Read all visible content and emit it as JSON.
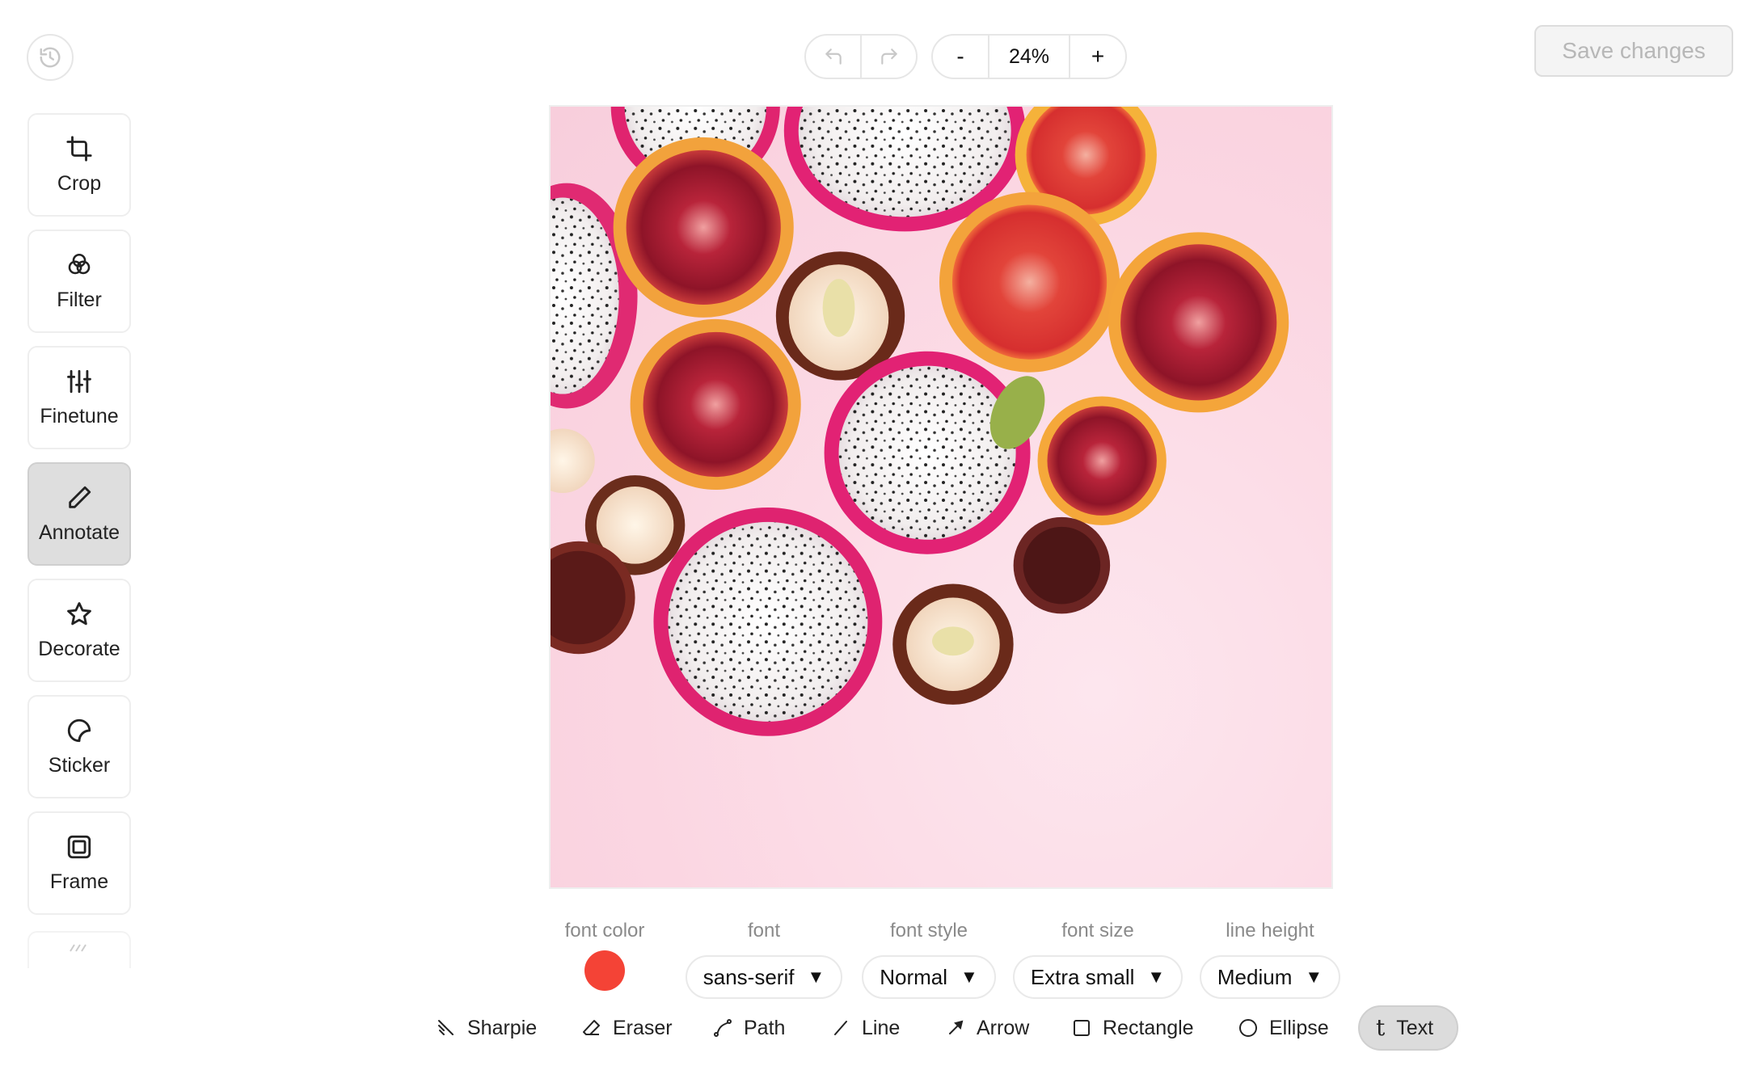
{
  "toolbar": {
    "zoom_out_label": "-",
    "zoom_value": "24%",
    "zoom_in_label": "+",
    "save_label": "Save changes"
  },
  "sidebar": {
    "items": [
      {
        "label": "Crop",
        "icon": "crop-icon"
      },
      {
        "label": "Filter",
        "icon": "filter-icon"
      },
      {
        "label": "Finetune",
        "icon": "sliders-icon"
      },
      {
        "label": "Annotate",
        "icon": "pencil-icon",
        "active": true
      },
      {
        "label": "Decorate",
        "icon": "star-icon"
      },
      {
        "label": "Sticker",
        "icon": "sticker-icon"
      },
      {
        "label": "Frame",
        "icon": "frame-icon"
      }
    ]
  },
  "text_settings": {
    "font_color": {
      "label": "font color",
      "value": "#f44336"
    },
    "font": {
      "label": "font",
      "value": "sans-serif"
    },
    "font_style": {
      "label": "font style",
      "value": "Normal"
    },
    "font_size": {
      "label": "font size",
      "value": "Extra small"
    },
    "line_height": {
      "label": "line height",
      "value": "Medium"
    }
  },
  "annotate_tools": [
    {
      "label": "Sharpie",
      "icon": "sharpie-icon"
    },
    {
      "label": "Eraser",
      "icon": "eraser-icon"
    },
    {
      "label": "Path",
      "icon": "path-icon"
    },
    {
      "label": "Line",
      "icon": "line-icon"
    },
    {
      "label": "Arrow",
      "icon": "arrow-icon"
    },
    {
      "label": "Rectangle",
      "icon": "rectangle-icon"
    },
    {
      "label": "Ellipse",
      "icon": "ellipse-icon"
    },
    {
      "label": "Text",
      "icon": "text-icon",
      "active": true
    }
  ],
  "colors": {
    "active_tool_bg": "#dedede",
    "save_disabled_text": "#b7b7b7",
    "font_color": "#f44336"
  }
}
